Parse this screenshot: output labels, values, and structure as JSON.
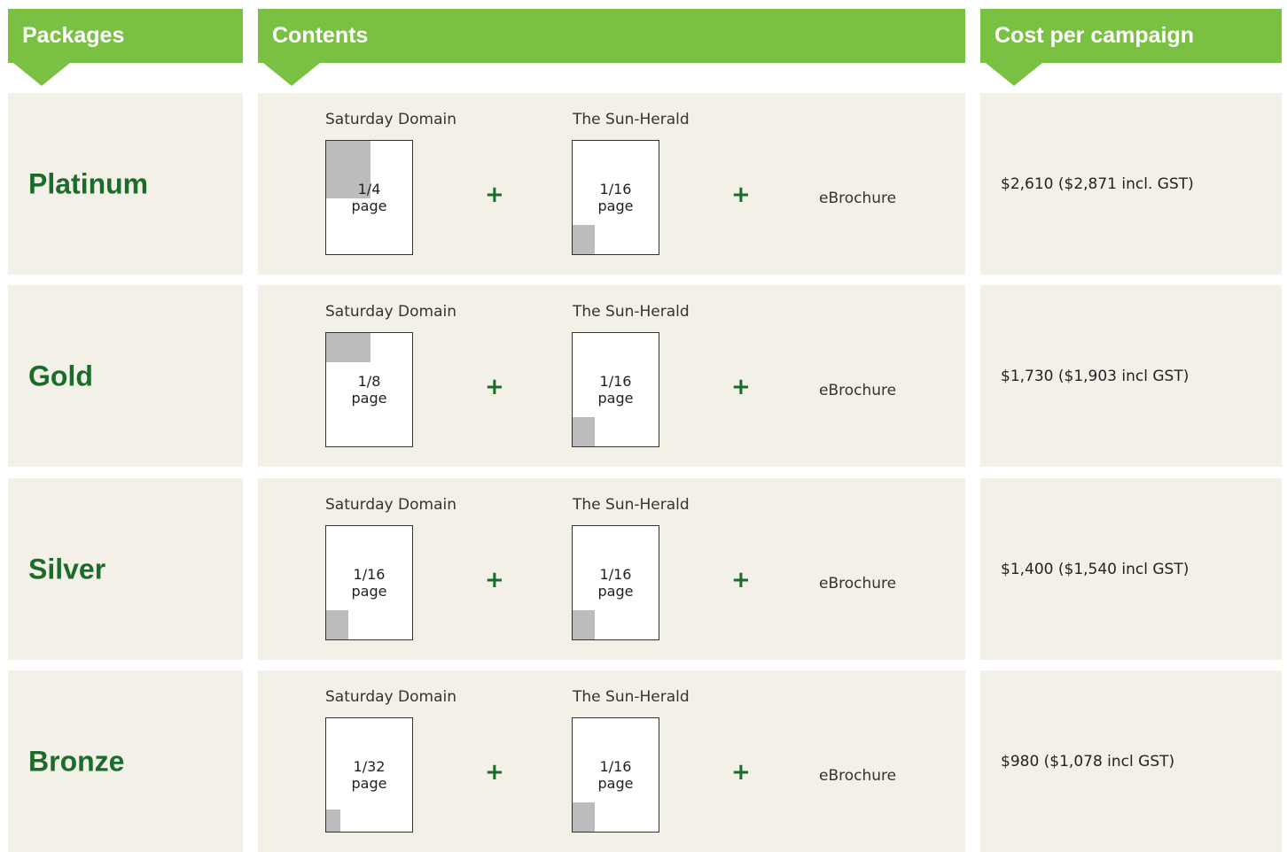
{
  "headers": {
    "packages": "Packages",
    "contents": "Contents",
    "cost": "Cost per campaign"
  },
  "colors": {
    "header_green": "#7ac143",
    "name_green": "#1b6b2a",
    "row_bg": "#f3f0e8",
    "ad_fill": "#bcbcbf"
  },
  "rows": [
    {
      "name": "Platinum",
      "pub1": {
        "label": "Saturday Domain",
        "fraction": "1/4",
        "unit": "page",
        "ad_share": 0.25
      },
      "pub2": {
        "label": "The Sun-Herald",
        "fraction": "1/16",
        "unit": "page",
        "ad_share": 0.0625
      },
      "plus": "+",
      "extra": "eBrochure",
      "cost": "$2,610 ($2,871 incl. GST)"
    },
    {
      "name": "Gold",
      "pub1": {
        "label": "Saturday Domain",
        "fraction": "1/8",
        "unit": "page",
        "ad_share": 0.125
      },
      "pub2": {
        "label": "The Sun-Herald",
        "fraction": "1/16",
        "unit": "page",
        "ad_share": 0.0625
      },
      "plus": "+",
      "extra": "eBrochure",
      "cost": "$1,730 ($1,903 incl GST)"
    },
    {
      "name": "Silver",
      "pub1": {
        "label": "Saturday Domain",
        "fraction": "1/16",
        "unit": "page",
        "ad_share": 0.0625
      },
      "pub2": {
        "label": "The Sun-Herald",
        "fraction": "1/16",
        "unit": "page",
        "ad_share": 0.0625
      },
      "plus": "+",
      "extra": "eBrochure",
      "cost": "$1,400 ($1,540 incl GST)"
    },
    {
      "name": "Bronze",
      "pub1": {
        "label": "Saturday Domain",
        "fraction": "1/32",
        "unit": "page",
        "ad_share": 0.03125
      },
      "pub2": {
        "label": "The Sun-Herald",
        "fraction": "1/16",
        "unit": "page",
        "ad_share": 0.0625
      },
      "plus": "+",
      "extra": "eBrochure",
      "cost": "$980 ($1,078 incl GST)"
    }
  ]
}
